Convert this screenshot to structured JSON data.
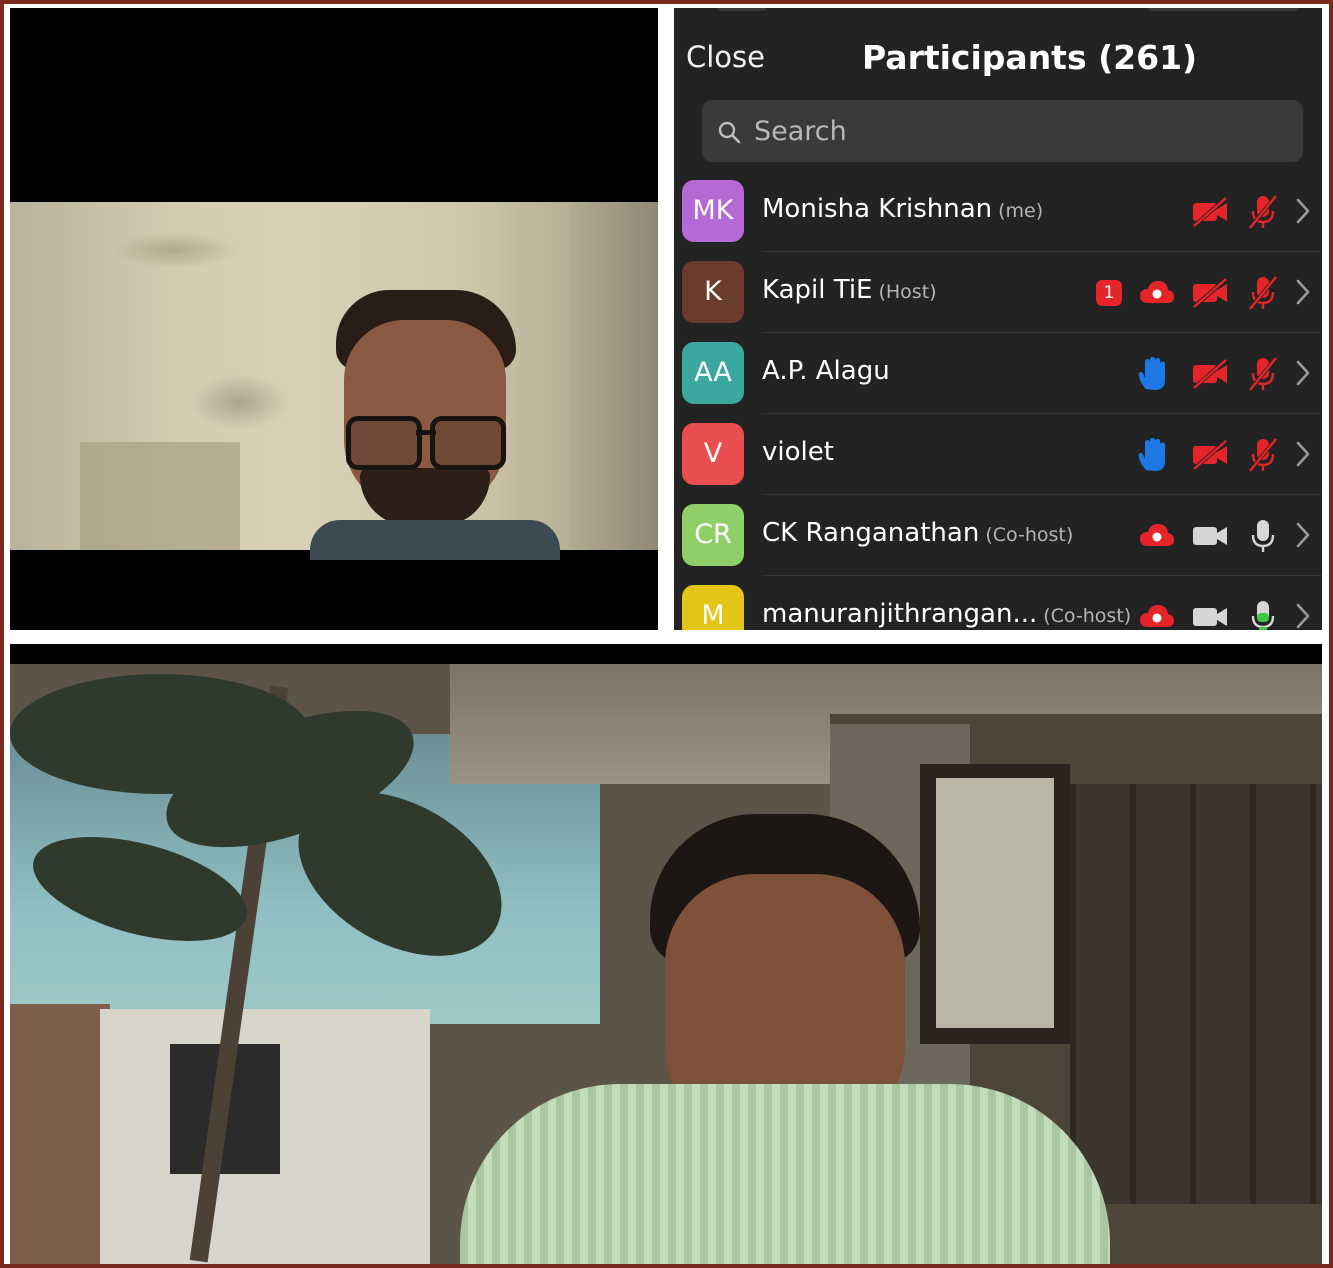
{
  "panel": {
    "close_label": "Close",
    "title": "Participants (261)",
    "search_placeholder": "Search"
  },
  "participants": [
    {
      "initials": "MK",
      "name": "Monisha Krishnan",
      "role": "(me)",
      "avatar_color": "#b469d6",
      "badge": null,
      "cloud": false,
      "raised_hand": false,
      "video": "off",
      "mic": "muted"
    },
    {
      "initials": "K",
      "name": "Kapil TiE",
      "role": "(Host)",
      "avatar_color": "#6b3b2c",
      "badge": "1",
      "cloud": true,
      "raised_hand": false,
      "video": "off",
      "mic": "muted"
    },
    {
      "initials": "AA",
      "name": "A.P. Alagu",
      "role": "",
      "avatar_color": "#3aa89f",
      "badge": null,
      "cloud": false,
      "raised_hand": true,
      "video": "off",
      "mic": "muted"
    },
    {
      "initials": "V",
      "name": "violet",
      "role": "",
      "avatar_color": "#ea4f4f",
      "badge": null,
      "cloud": false,
      "raised_hand": true,
      "video": "off",
      "mic": "muted"
    },
    {
      "initials": "CR",
      "name": "CK Ranganathan",
      "role": "(Co-host)",
      "avatar_color": "#8fcf68",
      "badge": null,
      "cloud": true,
      "raised_hand": false,
      "video": "on",
      "mic": "on"
    },
    {
      "initials": "M",
      "name": "manuranjithrangan...",
      "role": "(Co-host)",
      "avatar_color": "#e2c516",
      "badge": null,
      "cloud": true,
      "raised_hand": false,
      "video": "on",
      "mic": "speaking"
    }
  ],
  "colors": {
    "muted_red": "#e5252a",
    "raised_hand_blue": "#1e78e6",
    "neutral_icon": "#d6d6d6",
    "speaking_green": "#3ec93e",
    "panel_bg": "#232323"
  },
  "icons": {
    "search": "search-icon",
    "video_off": "video-off-icon",
    "video_on": "video-camera-icon",
    "mic_muted": "mic-muted-icon",
    "mic_on": "mic-icon",
    "cloud": "cloud-recording-icon",
    "hand": "raised-hand-icon",
    "chevron": "chevron-right-icon"
  }
}
